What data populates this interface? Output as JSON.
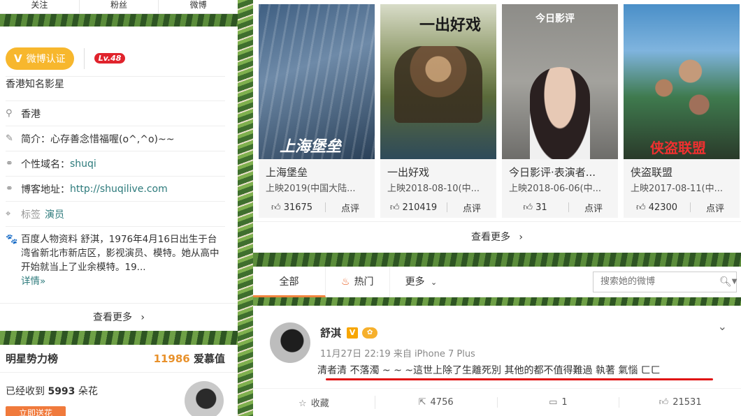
{
  "top_tabs": [
    "关注",
    "粉丝",
    "微博"
  ],
  "profile": {
    "verify_label": "微博认证",
    "level": "Lv.48",
    "description": "香港知名影星",
    "location": "香港",
    "intro_label": "简介：",
    "intro_value": "心存善念惜福喔(o^,^o)~~",
    "domain_label": "个性域名：",
    "domain_value": "shuqi",
    "blog_label": "博客地址：",
    "blog_value": "http://shuqilive.com",
    "tag_label": "标签",
    "tag_value": "演员",
    "bio": "百度人物资料 舒淇，1976年4月16日出生于台湾省新北市新店区，影视演员、模特。她从高中开始就当上了业余模特。19...",
    "bio_more": "详情»",
    "see_more": "查看更多"
  },
  "power": {
    "title": "明星势力榜",
    "score": "11986",
    "score_label": "爱慕值",
    "received_prefix": "已经收到",
    "flowers": "5993",
    "received_suffix": "朵花",
    "send_button": "立即送花"
  },
  "movies": [
    {
      "title": "上海堡垒",
      "date": "上映2019(中国大陆...",
      "likes": "31675",
      "review": "点评",
      "poster_text": "上海堡垒"
    },
    {
      "title": "一出好戏",
      "date": "上映2018-08-10(中...",
      "likes": "210419",
      "review": "点评",
      "poster_text": "一出好戏"
    },
    {
      "title": "今日影评·表演者...",
      "date": "上映2018-06-06(中...",
      "likes": "31",
      "review": "点评",
      "poster_text": "今日影评"
    },
    {
      "title": "侠盗联盟",
      "date": "上映2017-08-11(中...",
      "likes": "42300",
      "review": "点评",
      "poster_text": "侠盗联盟"
    }
  ],
  "movies_see_more": "查看更多",
  "feed_tabs": {
    "all": "全部",
    "hot": "热门",
    "more": "更多"
  },
  "search": {
    "placeholder": "搜索她的微博"
  },
  "post": {
    "name": "舒淇",
    "meta": "11月27日 22:19 来自 iPhone 7 Plus",
    "text": "清者清 不落濁 ~ ~ ~這世上除了生離死別 其他的都不值得難過 執著 氣惱 ㄈㄈ",
    "favorite": "收藏",
    "reposts": "4756",
    "comments": "1",
    "likes": "21531"
  },
  "colors": {
    "accent": "#f7b72d",
    "link": "#2c7a7b",
    "hot": "#e8591a",
    "underline": "#e01010"
  }
}
